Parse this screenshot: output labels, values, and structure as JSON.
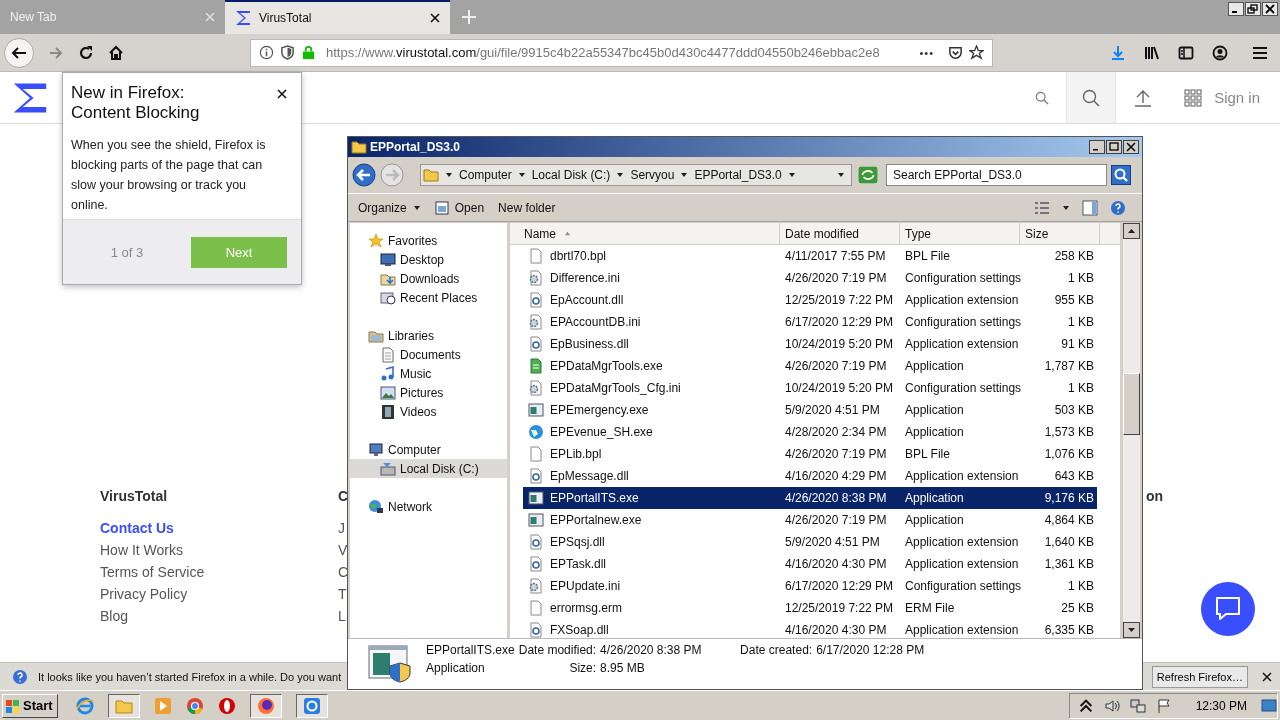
{
  "browser": {
    "tabs": [
      {
        "label": "New Tab",
        "selected": false
      },
      {
        "label": "VirusTotal",
        "selected": true
      }
    ],
    "url_parts": [
      {
        "text": "https://www.",
        "kind": "dim"
      },
      {
        "text": "virustotal.com",
        "kind": "host"
      },
      {
        "text": "/gui/file/9915c4b22a55347bc45b0d430c4477ddd04550b246ebbac2e8",
        "kind": "dim"
      }
    ],
    "more": "•••"
  },
  "page": {
    "sign_in": "Sign in",
    "footer": [
      {
        "heading": "VirusTotal",
        "links": [
          {
            "label": "Contact Us",
            "selected": true
          },
          {
            "label": "How It Works",
            "selected": false
          },
          {
            "label": "Terms of Service",
            "selected": false
          },
          {
            "label": "Privacy Policy",
            "selected": false
          },
          {
            "label": "Blog",
            "selected": false
          }
        ]
      },
      {
        "heading": "C",
        "links": [
          {
            "label": "J",
            "selected": false
          },
          {
            "label": "V",
            "selected": false
          },
          {
            "label": "C",
            "selected": false
          },
          {
            "label": "T",
            "selected": false
          },
          {
            "label": "L",
            "selected": false
          }
        ]
      },
      {
        "heading": "on"
      }
    ]
  },
  "popup": {
    "title": "New in Firefox: Content Blocking",
    "body": "When you see the shield, Firefox is blocking parts of the page that can slow your browsing or track you online.",
    "pager": "1 of 3",
    "button": "Next"
  },
  "notification": {
    "text": "It looks like you haven’t started Firefox in a while. Do you want",
    "button": "Refresh Firefox…"
  },
  "explorer": {
    "title": "EPPortal_DS3.0",
    "breadcrumb": [
      "Computer",
      "Local Disk (C:)",
      "Servyou",
      "EPPortal_DS3.0"
    ],
    "search": {
      "placeholder": "Search EPPortal_DS3.0"
    },
    "toolbar": [
      {
        "label": "Organize",
        "kind": "menu"
      },
      {
        "label": "Open",
        "kind": "icon"
      },
      {
        "label": "New folder",
        "kind": "plain"
      }
    ],
    "tree": [
      {
        "label": "Favorites",
        "selected": false,
        "children": [
          {
            "label": "Desktop",
            "selected": false
          },
          {
            "label": "Downloads",
            "selected": false
          },
          {
            "label": "Recent Places",
            "selected": false
          }
        ]
      },
      {
        "label": "Libraries",
        "selected": false,
        "children": [
          {
            "label": "Documents",
            "selected": false
          },
          {
            "label": "Music",
            "selected": false
          },
          {
            "label": "Pictures",
            "selected": false
          },
          {
            "label": "Videos",
            "selected": false
          }
        ]
      },
      {
        "label": "Computer",
        "selected": false,
        "children": [
          {
            "label": "Local Disk (C:)",
            "selected": true
          }
        ]
      },
      {
        "label": "Network",
        "selected": false
      }
    ],
    "columns": [
      "Name",
      "Date modified",
      "Type",
      "Size"
    ],
    "rows": [
      {
        "name": "dbrtl70.bpl",
        "date": "4/11/2017 7:55 PM",
        "type": "BPL File",
        "size": "258 KB",
        "kind": "blank",
        "selected": false
      },
      {
        "name": "Difference.ini",
        "date": "4/26/2020 7:19 PM",
        "type": "Configuration settings",
        "size": "1 KB",
        "kind": "config",
        "selected": false
      },
      {
        "name": "EpAccount.dll",
        "date": "12/25/2019 7:22 PM",
        "type": "Application extension",
        "size": "955 KB",
        "kind": "dll",
        "selected": false
      },
      {
        "name": "EPAccountDB.ini",
        "date": "6/17/2020 12:29 PM",
        "type": "Configuration settings",
        "size": "1 KB",
        "kind": "config",
        "selected": false
      },
      {
        "name": "EpBusiness.dll",
        "date": "10/24/2019 5:20 PM",
        "type": "Application extension",
        "size": "91 KB",
        "kind": "dll",
        "selected": false
      },
      {
        "name": "EPDataMgrTools.exe",
        "date": "4/26/2020 7:19 PM",
        "type": "Application",
        "size": "1,787 KB",
        "kind": "tool",
        "selected": false
      },
      {
        "name": "EPDataMgrTools_Cfg.ini",
        "date": "10/24/2019 5:20 PM",
        "type": "Configuration settings",
        "size": "1 KB",
        "kind": "config",
        "selected": false
      },
      {
        "name": "EPEmergency.exe",
        "date": "5/9/2020 4:51 PM",
        "type": "Application",
        "size": "503 KB",
        "kind": "app",
        "selected": false
      },
      {
        "name": "EPEvenue_SH.exe",
        "date": "4/28/2020 2:34 PM",
        "type": "Application",
        "size": "1,573 KB",
        "kind": "globe",
        "selected": false
      },
      {
        "name": "EPLib.bpl",
        "date": "4/26/2020 7:19 PM",
        "type": "BPL File",
        "size": "1,076 KB",
        "kind": "blank",
        "selected": false
      },
      {
        "name": "EpMessage.dll",
        "date": "4/16/2020 4:29 PM",
        "type": "Application extension",
        "size": "643 KB",
        "kind": "dll",
        "selected": false
      },
      {
        "name": "EPPortalITS.exe",
        "date": "4/26/2020 8:38 PM",
        "type": "Application",
        "size": "9,176 KB",
        "kind": "app",
        "selected": true
      },
      {
        "name": "EPPortalnew.exe",
        "date": "4/26/2020 7:19 PM",
        "type": "Application",
        "size": "4,864 KB",
        "kind": "app",
        "selected": false
      },
      {
        "name": "EPSqsj.dll",
        "date": "5/9/2020 4:51 PM",
        "type": "Application extension",
        "size": "1,640 KB",
        "kind": "dll",
        "selected": false
      },
      {
        "name": "EPTask.dll",
        "date": "4/16/2020 4:30 PM",
        "type": "Application extension",
        "size": "1,361 KB",
        "kind": "dll",
        "selected": false
      },
      {
        "name": "EPUpdate.ini",
        "date": "6/17/2020 12:29 PM",
        "type": "Configuration settings",
        "size": "1 KB",
        "kind": "config",
        "selected": false
      },
      {
        "name": "errormsg.erm",
        "date": "12/25/2019 7:22 PM",
        "type": "ERM File",
        "size": "25 KB",
        "kind": "blank",
        "selected": false
      },
      {
        "name": "FXSoap.dll",
        "date": "4/16/2020 4:30 PM",
        "type": "Application extension",
        "size": "6,335 KB",
        "kind": "dll",
        "selected": false
      }
    ],
    "details": {
      "name": "EPPortalITS.exe",
      "type": "Application",
      "modified_label": "Date modified:",
      "modified": "4/26/2020 8:38 PM",
      "created_label": "Date created:",
      "created": "6/17/2020 12:28 PM",
      "size_label": "Size:",
      "size": "8.95 MB"
    }
  },
  "taskbar": {
    "start": "Start",
    "clock": "12:30 PM"
  }
}
